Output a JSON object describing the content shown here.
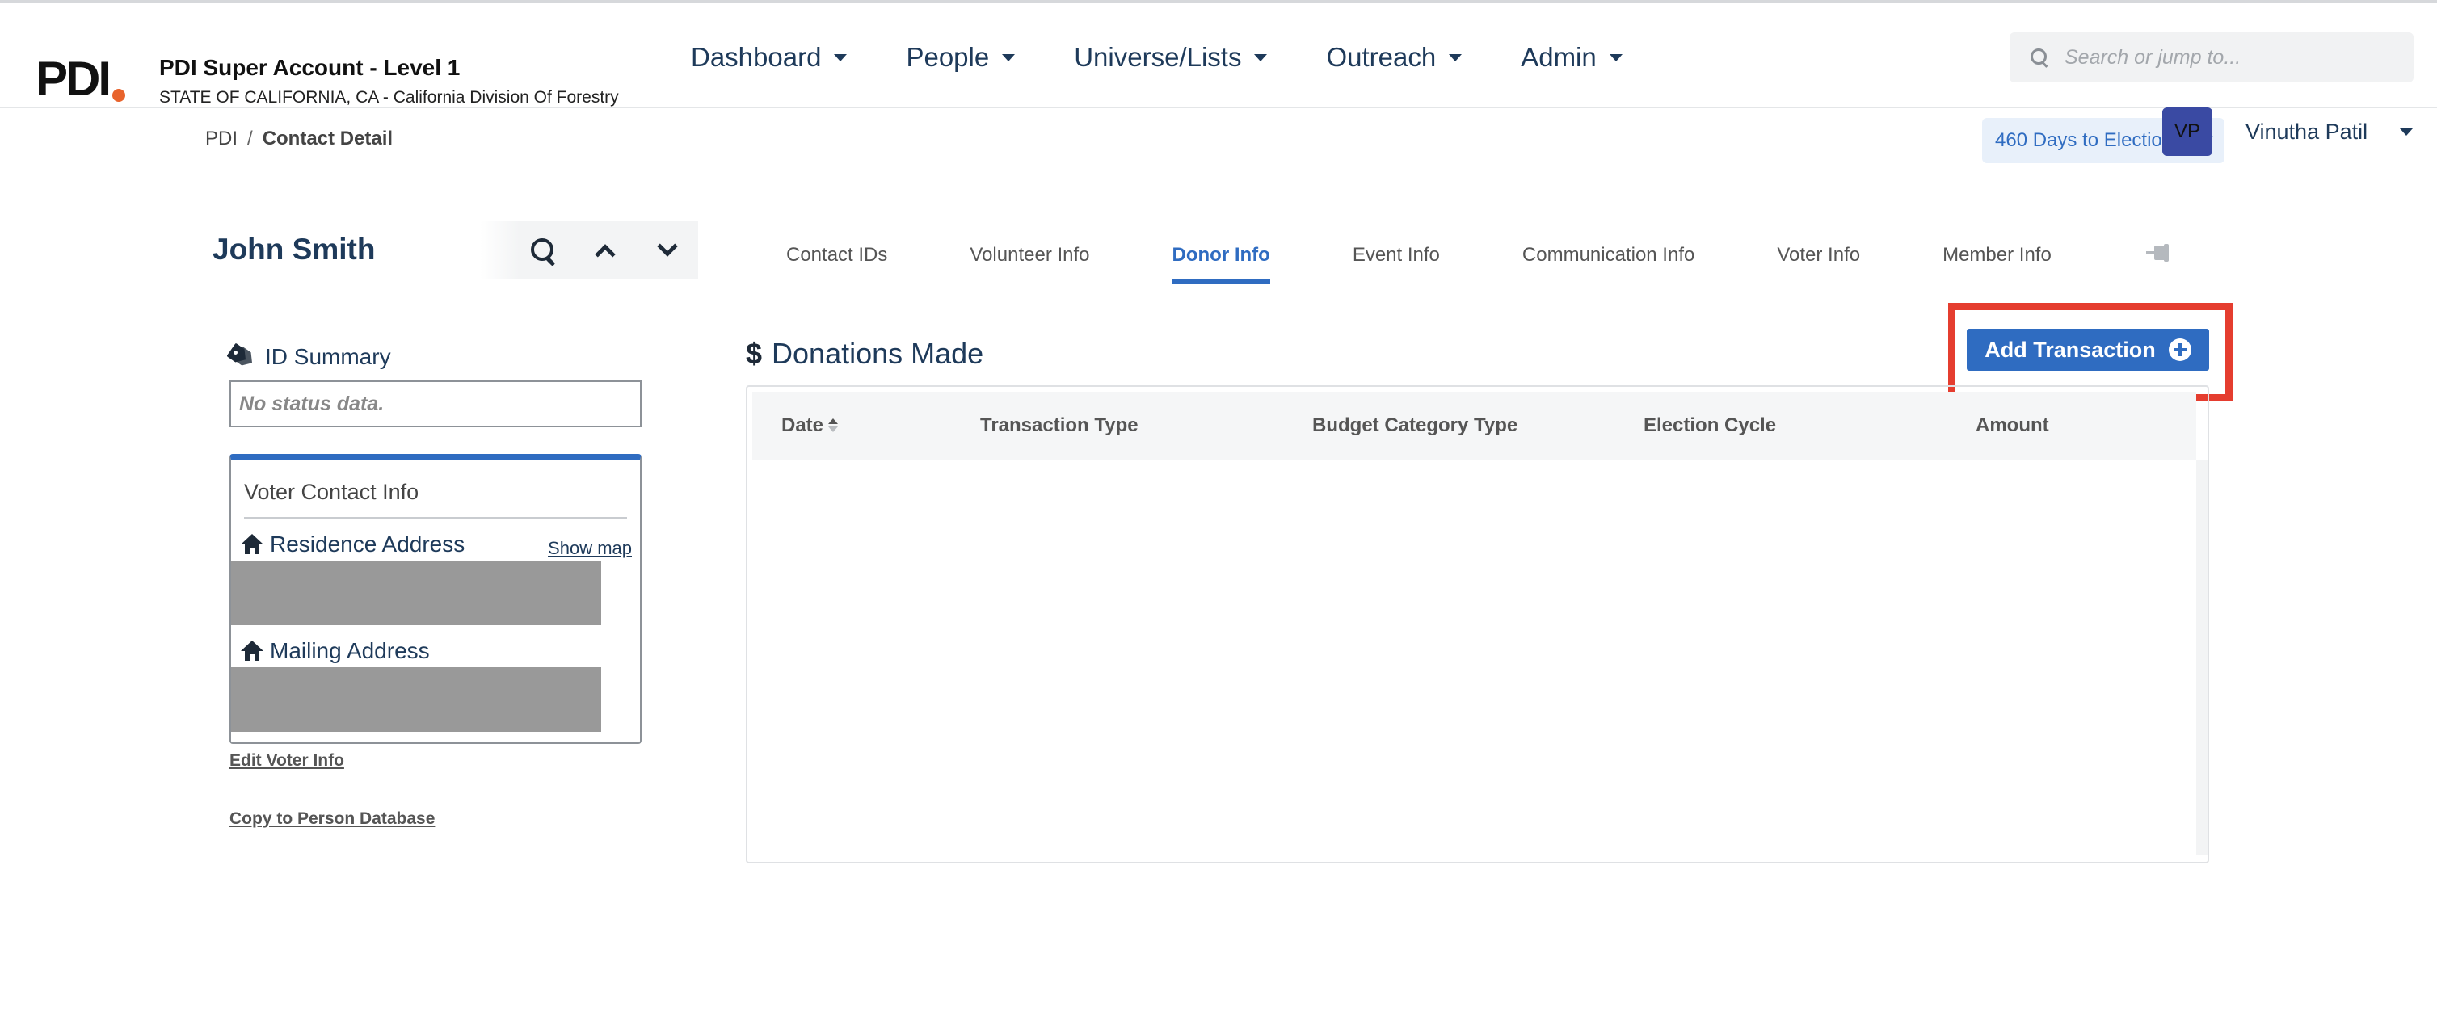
{
  "header": {
    "logo_text": "PDI",
    "account_name": "PDI Super Account - Level 1",
    "account_sub": "STATE OF CALIFORNIA, CA - California Division Of Forestry",
    "nav": [
      {
        "label": "Dashboard"
      },
      {
        "label": "People"
      },
      {
        "label": "Universe/Lists"
      },
      {
        "label": "Outreach"
      },
      {
        "label": "Admin"
      }
    ],
    "search_placeholder": "Search or jump to...",
    "icon": "search-icon"
  },
  "subheader": {
    "breadcrumb": [
      "PDI",
      "Contact Detail"
    ],
    "breadcrumb_sep": "/",
    "election_badge": "460 Days to Election Day",
    "avatar_initials": "VP",
    "user_name": "Vinutha Patil"
  },
  "contact": {
    "name": "John Smith",
    "tabs": [
      {
        "label": "Contact IDs",
        "active": false
      },
      {
        "label": "Volunteer Info",
        "active": false
      },
      {
        "label": "Donor Info",
        "active": true
      },
      {
        "label": "Event Info",
        "active": false
      },
      {
        "label": "Communication Info",
        "active": false
      },
      {
        "label": "Voter Info",
        "active": false
      },
      {
        "label": "Member Info",
        "active": false
      }
    ]
  },
  "left_panel": {
    "id_summary_title": "ID Summary",
    "status_text": "No status data.",
    "voter_contact_title": "Voter Contact Info",
    "residence_label": "Residence Address",
    "show_map": "Show map",
    "mailing_label": "Mailing Address",
    "edit_voter_info": "Edit Voter Info",
    "copy_to_person": "Copy to Person Database"
  },
  "donations": {
    "title": "Donations Made",
    "title_symbol": "$",
    "add_button": "Add Transaction",
    "columns": [
      "Date",
      "Transaction Type",
      "Budget Category Type",
      "Election Cycle",
      "Amount"
    ],
    "rows": []
  },
  "colors": {
    "accent": "#2f6cc1",
    "highlight_frame": "#e53d2f",
    "logo_dot": "#e8632c"
  }
}
